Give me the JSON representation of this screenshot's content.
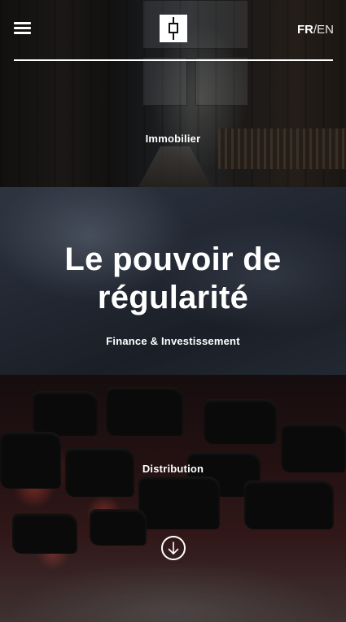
{
  "header": {
    "menu_icon": "hamburger-menu-icon",
    "logo_icon": "square-logo-icon",
    "lang": {
      "fr": "FR",
      "separator": "/",
      "en": "EN",
      "active": "FR"
    }
  },
  "panels": [
    {
      "label": "Immobilier"
    },
    {
      "headline_line1": "Le pouvoir de",
      "headline_line2": "régularité",
      "label": "Finance & Investissement"
    },
    {
      "label": "Distribution"
    }
  ],
  "scroll": {
    "icon": "arrow-down-circle-icon"
  },
  "colors": {
    "text": "#ffffff",
    "overlay": "#000000"
  }
}
